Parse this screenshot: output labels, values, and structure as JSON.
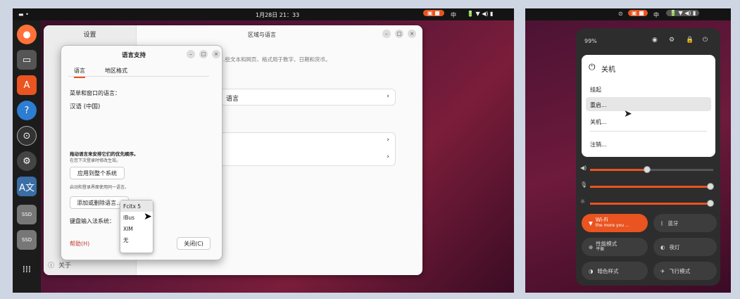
{
  "topbar": {
    "clock": "1月28日 21：33",
    "input": "中"
  },
  "settings": {
    "sidebar_title": "设置",
    "window_title": "区域与语言",
    "about": "关于",
    "desc": "…些文本和网页、格式用于数字、日期和货币。",
    "row1": "语言",
    "chevron": "›"
  },
  "dialog": {
    "title": "语言支持",
    "tab_lang": "语言",
    "tab_region": "地区格式",
    "menu_lang_label": "菜单和窗口的语言：",
    "selected_lang": "汉语 (中国)",
    "drag_hint": "拖动语言来安排它们的优先顺序。",
    "drag_sub": "在您下次登录时修改生效。",
    "apply_btn": "应用到整个系统",
    "login_hint": "启动和登录界面使用同一语言。",
    "add_btn": "添加或删除语言...",
    "input_label": "键盘输入法系统：",
    "help": "帮助(H)",
    "close": "关闭(C)",
    "options": [
      "Fcitx 5",
      "IBus",
      "XIM",
      "无"
    ]
  },
  "quick": {
    "battery": "99%",
    "power_title": "关机",
    "items": [
      "挂起",
      "重启...",
      "关机...",
      "注销..."
    ],
    "wifi": "Wi-Fi",
    "wifi_sub": "the more you ...",
    "bluetooth": "蓝牙",
    "perf": "性能模式",
    "perf_sub": "平衡",
    "night": "夜灯",
    "dark": "暗色样式",
    "airplane": "飞行模式"
  },
  "colors": {
    "accent": "#e95420",
    "bg": "#5a1638"
  }
}
